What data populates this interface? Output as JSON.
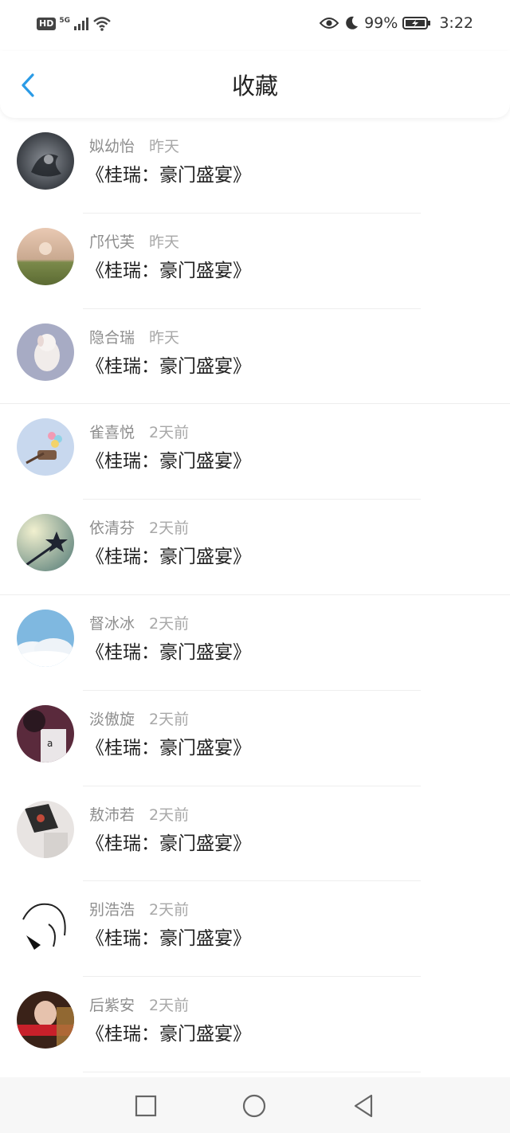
{
  "status_bar": {
    "hd": "HD",
    "net": "5G",
    "battery_pct": "99%",
    "time": "3:22"
  },
  "header": {
    "title": "收藏"
  },
  "items": [
    {
      "name": "姒幼怡",
      "time": "昨天",
      "title": "《桂瑞：豪门盛宴》"
    },
    {
      "name": "邝代芙",
      "time": "昨天",
      "title": "《桂瑞：豪门盛宴》"
    },
    {
      "name": "隐合瑞",
      "time": "昨天",
      "title": "《桂瑞：豪门盛宴》"
    },
    {
      "name": "雀喜悦",
      "time": "2天前",
      "title": "《桂瑞：豪门盛宴》"
    },
    {
      "name": "依清芬",
      "time": "2天前",
      "title": "《桂瑞：豪门盛宴》"
    },
    {
      "name": "督冰冰",
      "time": "2天前",
      "title": "《桂瑞：豪门盛宴》"
    },
    {
      "name": "淡傲旋",
      "time": "2天前",
      "title": "《桂瑞：豪门盛宴》"
    },
    {
      "name": "敖沛若",
      "time": "2天前",
      "title": "《桂瑞：豪门盛宴》"
    },
    {
      "name": "别浩浩",
      "time": "2天前",
      "title": "《桂瑞：豪门盛宴》"
    },
    {
      "name": "后紫安",
      "time": "2天前",
      "title": "《桂瑞：豪门盛宴》"
    }
  ],
  "colors": {
    "accent": "#2b9be6",
    "meta_text": "#8e8e8e",
    "title_text": "#222222"
  }
}
